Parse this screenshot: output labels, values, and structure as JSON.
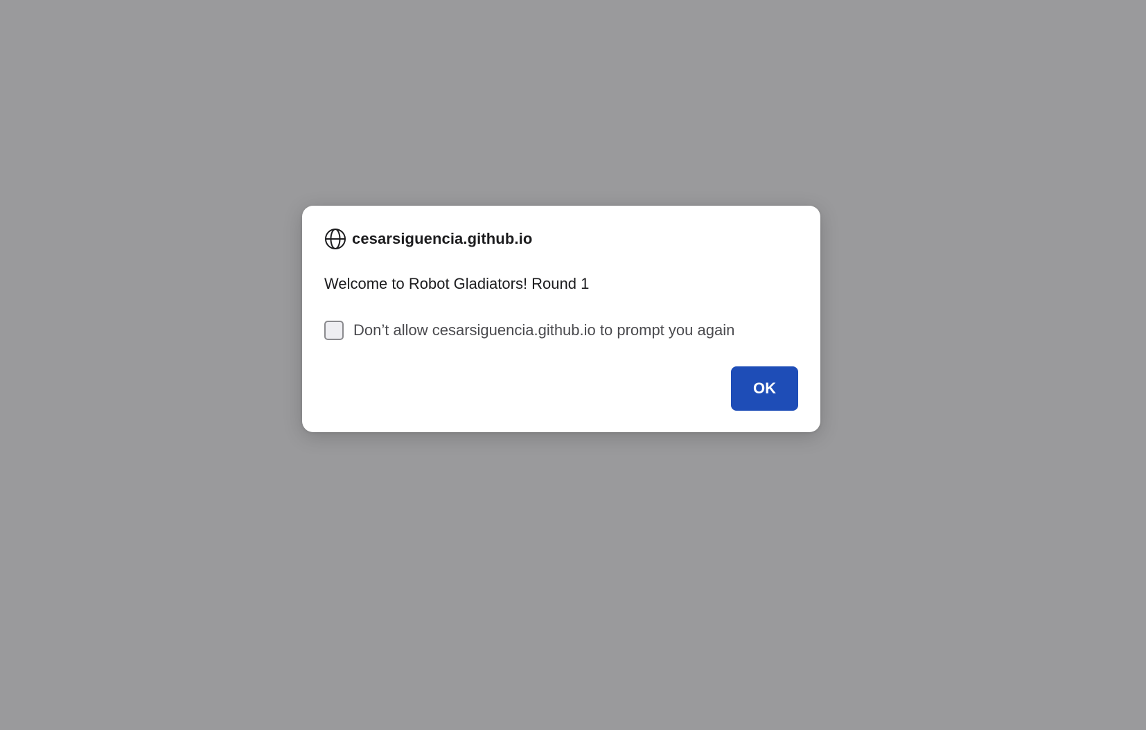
{
  "dialog": {
    "site": "cesarsiguencia.github.io",
    "message": "Welcome to Robot Gladiators! Round 1",
    "checkbox_label": "Don’t allow cesarsiguencia.github.io to prompt you again",
    "checkbox_checked": false,
    "ok_label": "OK",
    "icon": "globe-icon"
  },
  "colors": {
    "overlay": "#9a9a9c",
    "dialog_bg": "#ffffff",
    "primary_button": "#1e4db7",
    "text": "#1c1c1e",
    "secondary_text": "#4a4a4e"
  }
}
